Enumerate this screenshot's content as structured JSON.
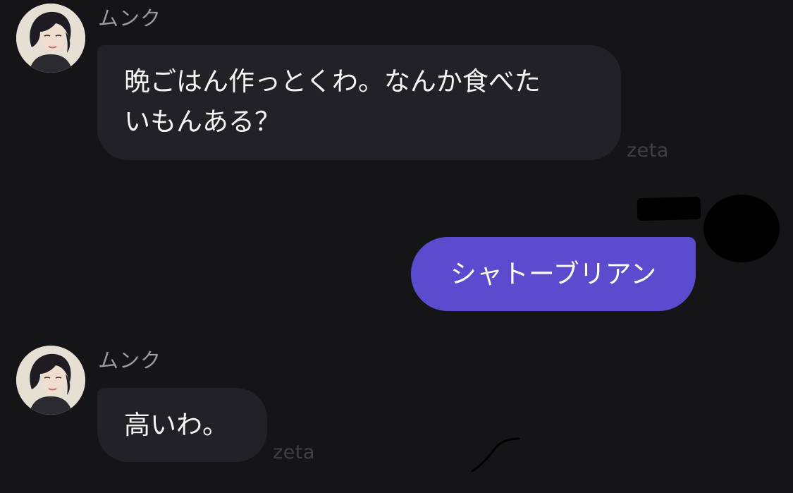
{
  "messages": [
    {
      "sender": "ムンク",
      "lines": [
        "晩ごはん作っとくわ。なんか食べた",
        "いもんある？"
      ],
      "watermark": "zeta"
    },
    {
      "text": "シャトーブリアン"
    },
    {
      "sender": "ムンク",
      "text": "高いわ。",
      "watermark": "zeta"
    }
  ],
  "colors": {
    "background": "#151518",
    "incoming_bubble": "#222226",
    "outgoing_bubble": "#5b4bcf",
    "sender_name": "#9a9aa0",
    "watermark": "#3f3f44"
  },
  "icons": {
    "avatar": "character-avatar-icon"
  }
}
